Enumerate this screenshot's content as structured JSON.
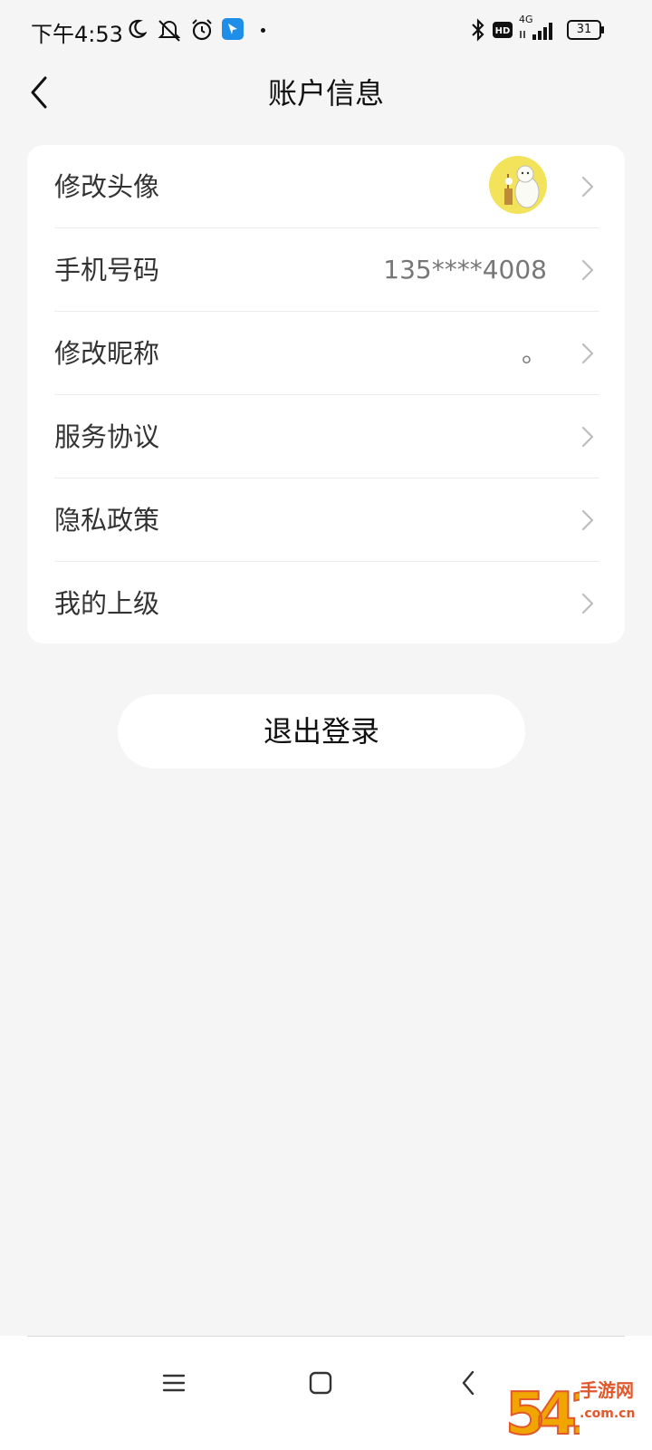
{
  "status_bar": {
    "time": "下午4:53",
    "network": "4G",
    "hd_badge": "HD",
    "battery": "31"
  },
  "header": {
    "title": "账户信息"
  },
  "rows": [
    {
      "label": "修改头像",
      "value": ""
    },
    {
      "label": "手机号码",
      "value": "135****4008"
    },
    {
      "label": "修改昵称",
      "value": "。"
    },
    {
      "label": "服务协议",
      "value": ""
    },
    {
      "label": "隐私政策",
      "value": ""
    },
    {
      "label": "我的上级",
      "value": ""
    }
  ],
  "logout_label": "退出登录",
  "watermark": {
    "logo": "5419",
    "name": "手游网",
    "domain": ".com.cn"
  },
  "colors": {
    "background": "#f5f5f5",
    "card": "#ffffff",
    "watermark": "#e0582c",
    "avatar_bg": "#f2e35a"
  }
}
